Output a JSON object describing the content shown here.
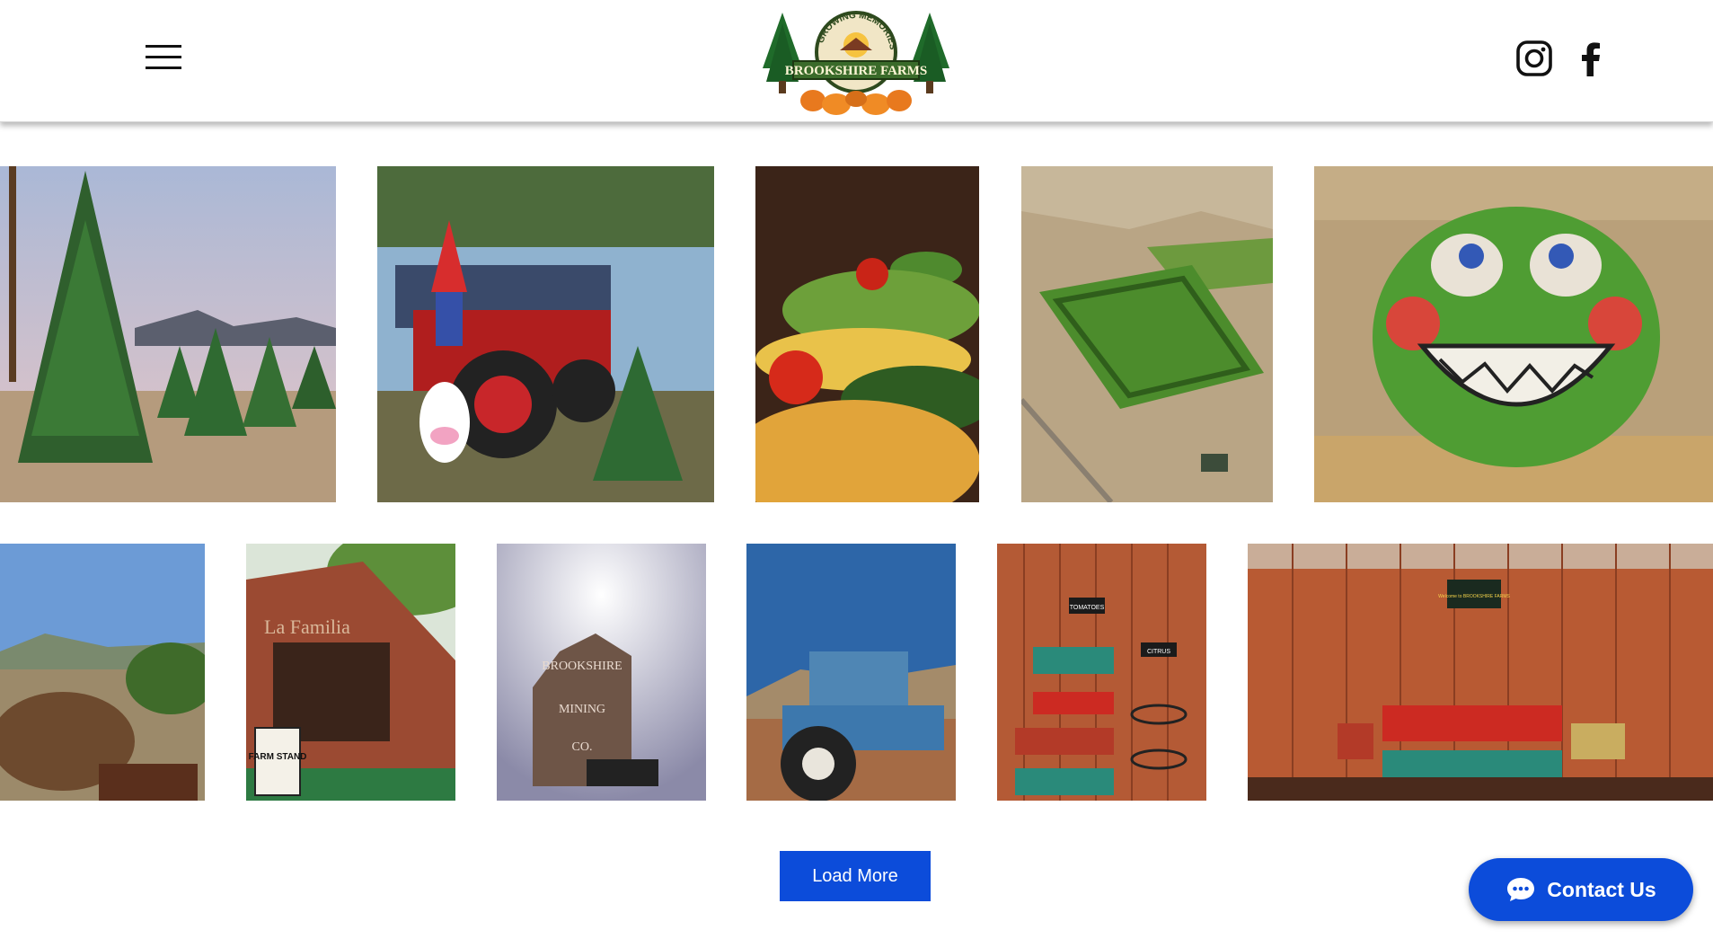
{
  "header": {
    "menu_icon": "hamburger-menu-icon",
    "logo": {
      "arc_text": "GROWING MEMORIES",
      "name": "BROOKSHIRE FARMS"
    },
    "social": [
      {
        "name": "instagram",
        "icon": "instagram-icon"
      },
      {
        "name": "facebook",
        "icon": "facebook-icon"
      }
    ]
  },
  "gallery": {
    "row1": [
      {
        "subject": "christmas-trees"
      },
      {
        "subject": "red-tractor-with-gnome"
      },
      {
        "subject": "vegetables"
      },
      {
        "subject": "corn-maze-aerial"
      },
      {
        "subject": "hay-bale-face"
      }
    ],
    "row2": [
      {
        "subject": "saddle-hills"
      },
      {
        "subject": "red-barn-farm-stand",
        "sign_text": "FARM STAND",
        "barn_text": "La Familia"
      },
      {
        "subject": "water-tower",
        "lines": [
          "BROOKSHIRE",
          "MINING",
          "CO."
        ]
      },
      {
        "subject": "blue-tractor"
      },
      {
        "subject": "produce-stand",
        "signs": [
          "TOMATOES",
          "CITRUS"
        ]
      },
      {
        "subject": "produce-barn-interior",
        "sign_text": "Welcome to BROOKSHIRE FARMS"
      }
    ]
  },
  "actions": {
    "load_more_label": "Load More"
  },
  "chat": {
    "label": "Contact Us",
    "icon": "chat-bubble-icon"
  },
  "colors": {
    "accent": "#0c4cda",
    "header_bg": "#ffffff"
  }
}
